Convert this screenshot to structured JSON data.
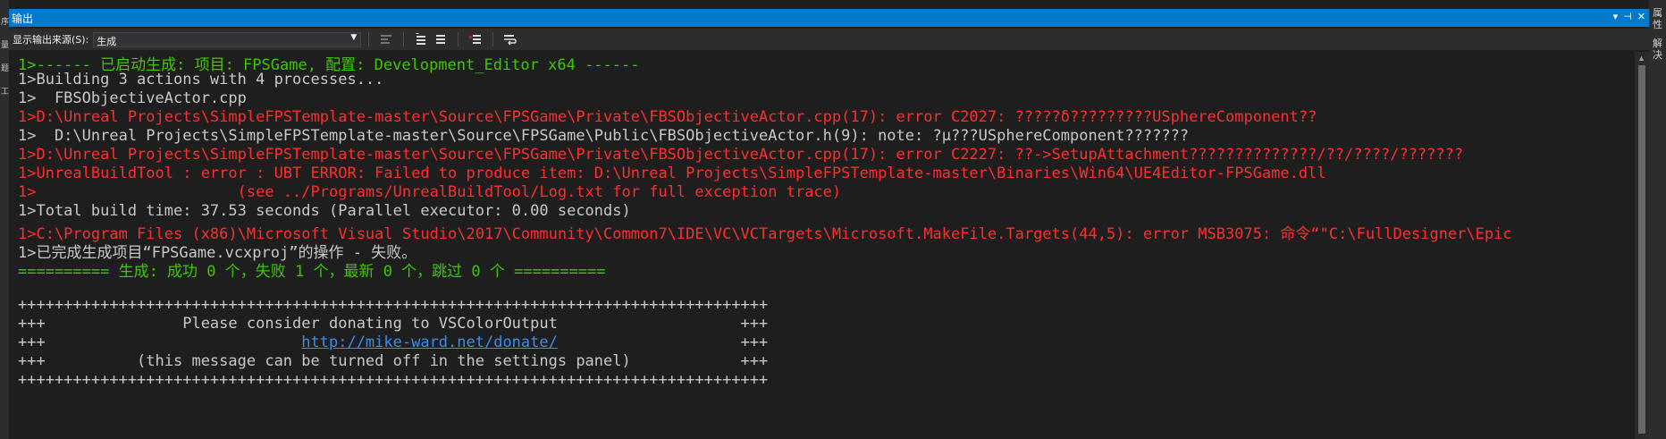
{
  "left_strip": {
    "marks": [
      "序",
      "量",
      "题",
      "工"
    ]
  },
  "right_strip": {
    "tabs": [
      "属性",
      "解决"
    ]
  },
  "window": {
    "title": "输出",
    "controls": [
      "▾",
      "⊣",
      "✕"
    ]
  },
  "toolbar": {
    "source_label": "显示输出来源(S):",
    "source_value": "生成"
  },
  "lines": [
    {
      "color": "c-green",
      "text": "1>------ 已启动生成: 项目: FPSGame, 配置: Development_Editor x64 ------"
    },
    {
      "color": "c-gray",
      "text": "1>Building 3 actions with 4 processes..."
    },
    {
      "color": "c-gray",
      "text": "1>  FBSObjectiveActor.cpp"
    },
    {
      "color": "c-red",
      "text": "1>D:\\Unreal Projects\\SimpleFPSTemplate-master\\Source\\FPSGame\\Private\\FBSObjectiveActor.cpp(17): error C2027: ?????δ?????????USphereComponent??"
    },
    {
      "color": "c-gray",
      "text": "1>  D:\\Unreal Projects\\SimpleFPSTemplate-master\\Source\\FPSGame\\Public\\FBSObjectiveActor.h(9): note: ?μ???USphereComponent???????"
    },
    {
      "color": "c-red",
      "text": "1>D:\\Unreal Projects\\SimpleFPSTemplate-master\\Source\\FPSGame\\Private\\FBSObjectiveActor.cpp(17): error C2227: ??->SetupAttachment??????????????/??/????/???????"
    },
    {
      "color": "c-red",
      "text": "1>UnrealBuildTool : error : UBT ERROR: Failed to produce item: D:\\Unreal Projects\\SimpleFPSTemplate-master\\Binaries\\Win64\\UE4Editor-FPSGame.dll"
    },
    {
      "color": "c-red",
      "text": "1>                      (see ../Programs/UnrealBuildTool/Log.txt for full exception trace)"
    },
    {
      "color": "c-gray",
      "text": "1>Total build time: 37.53 seconds (Parallel executor: 0.00 seconds)"
    },
    {
      "color": "c-red",
      "text": "1>C:\\Program Files (x86)\\Microsoft Visual Studio\\2017\\Community\\Common7\\IDE\\VC\\VCTargets\\Microsoft.MakeFile.Targets(44,5): error MSB3075: 命令“\"C:\\FullDesigner\\Epic"
    },
    {
      "color": "c-gray",
      "text": "1>已完成生成项目“FPSGame.vcxproj”的操作 - 失败。"
    },
    {
      "color": "c-green",
      "text": "========== 生成: 成功 0 个，失败 1 个，最新 0 个，跳过 0 个 =========="
    },
    {
      "color": "c-gray",
      "text": ""
    },
    {
      "color": "c-gray",
      "text": "++++++++++++++++++++++++++++++++++++++++++++++++++++++++++++++++++++++++++++++++++"
    },
    {
      "color": "c-gray",
      "text": "+++               Please consider donating to VSColorOutput                    +++"
    },
    {
      "color": "c-gray",
      "text": "+++                                                                            +++"
    },
    {
      "color": "c-gray",
      "text": "+++          (this message can be turned off in the settings panel)            +++"
    },
    {
      "color": "c-gray",
      "text": "++++++++++++++++++++++++++++++++++++++++++++++++++++++++++++++++++++++++++++++++++"
    }
  ],
  "donate_link": "http://mike-ward.net/donate/"
}
